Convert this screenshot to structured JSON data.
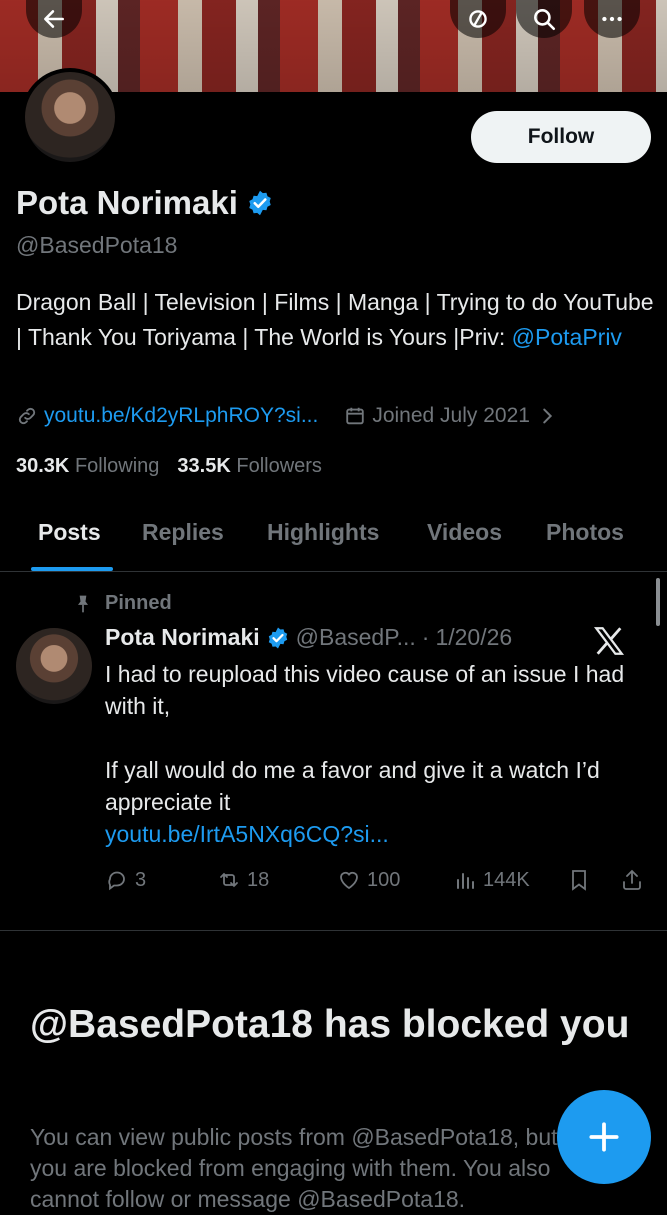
{
  "profile": {
    "name": "Pota Norimaki",
    "handle": "@BasedPota18",
    "bio_text": "Dragon Ball | Television | Films | Manga | Trying to do YouTube | Thank You Toriyama | The World is Yours |Priv: ",
    "bio_link": "@PotaPriv",
    "website": "youtu.be/Kd2yRLphROY?si...",
    "joined": "Joined July 2021",
    "following_count": "30.3K",
    "following_label": "Following",
    "followers_count": "33.5K",
    "followers_label": "Followers",
    "follow_button": "Follow"
  },
  "tabs": [
    "Posts",
    "Replies",
    "Highlights",
    "Videos",
    "Photos"
  ],
  "active_tab": "Posts",
  "pinned_post": {
    "pinned_label": "Pinned",
    "author": "Pota Norimaki",
    "handle": "@BasedP...",
    "date": "1/20/26",
    "text_1": "I had to reupload this video cause of an issue I had with it,",
    "text_2": "If yall would do me a favor and give it a watch I’d appreciate it",
    "link": "youtu.be/IrtA5NXq6CQ?si...",
    "replies": "3",
    "reposts": "18",
    "likes": "100",
    "views": "144K"
  },
  "blocked": {
    "title": "@BasedPota18 has blocked you",
    "text": "You can view public posts from @BasedPota18, but you are blocked from engaging with them. You also cannot follow or message @BasedPota18."
  },
  "colors": {
    "accent": "#1d9bf0",
    "background": "#000000",
    "muted": "#71767b"
  },
  "icons": [
    "back-arrow-icon",
    "translate-icon",
    "search-icon",
    "more-icon",
    "verified-icon",
    "link-icon",
    "calendar-icon",
    "pin-icon",
    "x-logo-icon",
    "reply-icon",
    "repost-icon",
    "like-icon",
    "views-icon",
    "bookmark-icon",
    "share-icon",
    "plus-icon"
  ]
}
